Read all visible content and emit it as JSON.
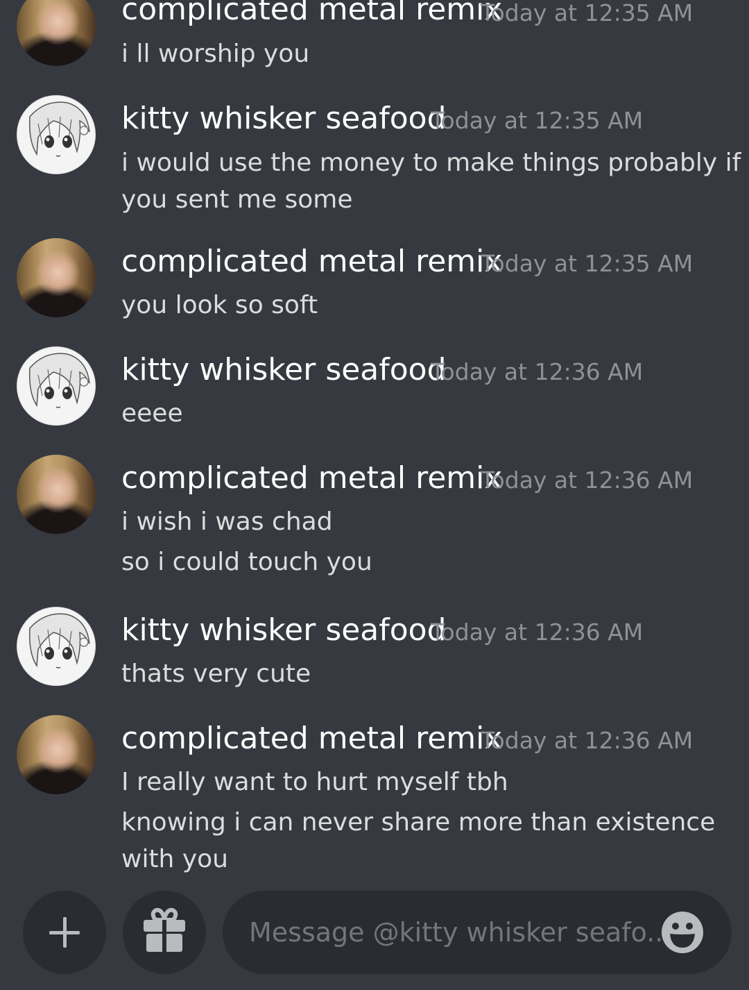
{
  "messages": [
    {
      "author": "complicated metal remix",
      "avatar": "cmr",
      "timestamp": "Today at 12:35 AM",
      "lines": [
        "i ll worship you"
      ]
    },
    {
      "author": "kitty whisker seafood",
      "avatar": "kws",
      "timestamp": "Today at 12:35 AM",
      "lines": [
        "i would use the money to make things probably if",
        "you sent me some"
      ]
    },
    {
      "author": "complicated metal remix",
      "avatar": "cmr",
      "timestamp": "Today at 12:35 AM",
      "lines": [
        "you look so soft"
      ]
    },
    {
      "author": "kitty whisker seafood",
      "avatar": "kws",
      "timestamp": "Today at 12:36 AM",
      "lines": [
        "eeee"
      ]
    },
    {
      "author": "complicated metal remix",
      "avatar": "cmr",
      "timestamp": "Today at 12:36 AM",
      "lines": [
        "i wish i was chad",
        "so i could touch you"
      ]
    },
    {
      "author": "kitty whisker seafood",
      "avatar": "kws",
      "timestamp": "Today at 12:36 AM",
      "lines": [
        "thats very cute"
      ]
    },
    {
      "author": "complicated metal remix",
      "avatar": "cmr",
      "timestamp": "Today at 12:36 AM",
      "lines": [
        "I really want to hurt myself tbh",
        "knowing i can never share more than existence",
        "with you"
      ]
    }
  ],
  "composer": {
    "placeholder": "Message @kitty whisker seafo...",
    "add_icon": "plus-icon",
    "gift_icon": "gift-icon",
    "emoji_icon": "emoji-smile-icon"
  },
  "colors": {
    "background": "#36393f",
    "username": "#ffffff",
    "timestamp": "#8e9297",
    "message_text": "#dcddde",
    "composer_bg": "#2a2c31",
    "icon": "#b9bbbe"
  }
}
